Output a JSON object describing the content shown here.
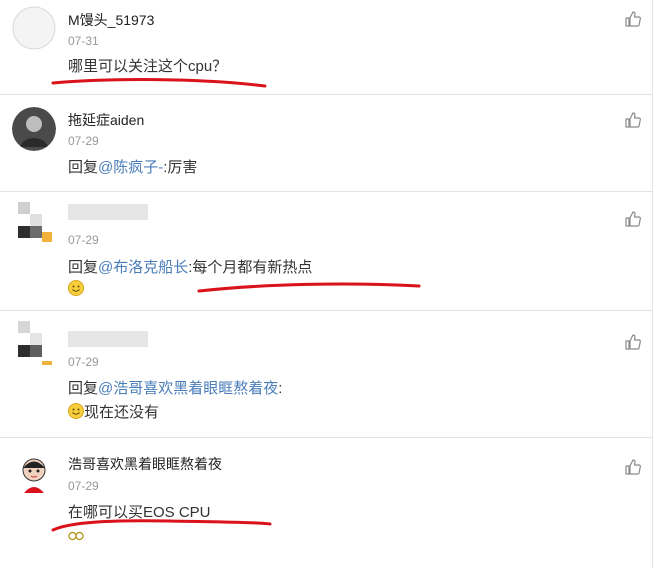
{
  "comments": [
    {
      "username": "M馒头_51973",
      "date": "07-31",
      "text": "哪里可以关注这个cpu？"
    },
    {
      "username": "拖延症aiden",
      "date": "07-29",
      "reply_prefix": "回复",
      "mention": "@陈疯子-",
      "text": ":厉害"
    },
    {
      "username": "",
      "date": "07-29",
      "reply_prefix": "回复",
      "mention": "@布洛克船长",
      "text": ":每个月都有新热点"
    },
    {
      "username": "",
      "date": "07-29",
      "reply_prefix": "回复",
      "mention": "@浩哥喜欢黑着眼眶熬着夜",
      "text": ":",
      "line2": "现在还没有"
    },
    {
      "username": "浩哥喜欢黑着眼眶熬着夜",
      "date": "07-29",
      "text": "在哪可以买EOS CPU"
    }
  ],
  "icons": {
    "like": "thumbs-up-icon",
    "smile": "smile-emoji-icon",
    "glasses": "glasses-emoji-icon"
  },
  "colors": {
    "mention": "#4a7db8",
    "underline": "#d9121b",
    "divider": "#e3e3e3"
  }
}
